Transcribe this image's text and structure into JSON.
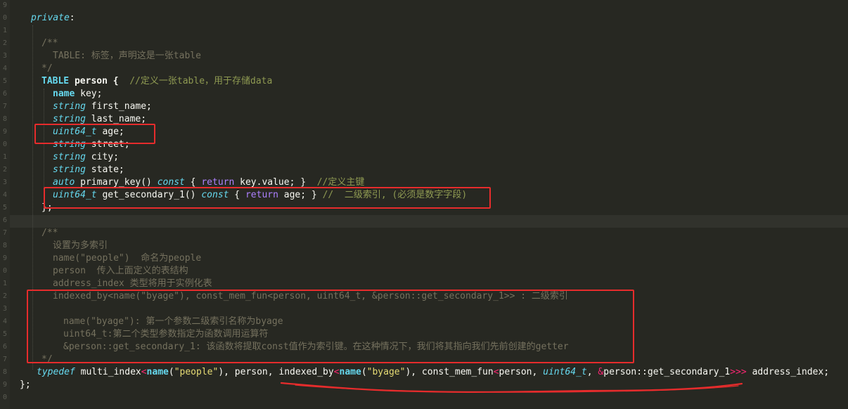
{
  "lines": {
    "l1": [
      "private",
      ":"
    ],
    "l2": [
      "/**"
    ],
    "l3": [
      "TABLE: 标签，声明这是一张table"
    ],
    "l4": [
      "*/"
    ],
    "l5": [
      "TABLE",
      " person {  ",
      "//定义一张table，用于存储data"
    ],
    "l6": [
      "name",
      " key;"
    ],
    "l7": [
      "string",
      " first_name;"
    ],
    "l8": [
      "string",
      " last_name;"
    ],
    "l9": [
      "uint64_t",
      " age;"
    ],
    "l10": [
      "string",
      " street;"
    ],
    "l11": [
      "string",
      " city;"
    ],
    "l12": [
      "string",
      " state;"
    ],
    "l13": [
      "auto",
      " primary_key() ",
      "const",
      " { ",
      "return",
      " key.value; }  ",
      "//定义主键"
    ],
    "l14": [
      "uint64_t",
      " get_secondary_1() ",
      "const",
      " { ",
      "return",
      " age; } ",
      "//  二级索引, (必须是数字字段)"
    ],
    "l15": [
      "};"
    ],
    "l16": [
      "/**"
    ],
    "l17": [
      "设置为多索引"
    ],
    "l18": [
      "name(\"people\")  命名为people"
    ],
    "l19": [
      "person  传入上面定义的表结构"
    ],
    "l20": [
      "address_index 类型将用于实例化表"
    ],
    "l21": [
      "indexed_by<name(\"byage\"), const_mem_fun<person, uint64_t, &person::get_secondary_1>> : 二级索引"
    ],
    "l22": [
      "name(\"byage\"): 第一个参数二级索引名称为byage"
    ],
    "l23": [
      "uint64_t:第二个类型参数指定为函数调用运算符"
    ],
    "l24": [
      "&person::get_secondary_1: 该函数将提取const值作为索引键。在这种情况下，我们将其指向我们先前创建的getter"
    ],
    "l25": [
      "*/"
    ],
    "l26": [
      "typedef",
      " multi_index",
      "<",
      "name",
      "(",
      "\"people\"",
      "), person, indexed_by",
      "<",
      "name",
      "(",
      "\"byage\"",
      "), const_mem_fun",
      "<",
      "person, ",
      "uint64_t",
      ", ",
      "&",
      "person::get_secondary_1",
      ">>>",
      " address_index;"
    ],
    "l27": [
      "};"
    ]
  },
  "gutter_marks": [
    "9",
    "0",
    "1",
    "2",
    "3",
    "4",
    "5",
    "6",
    "7",
    "8",
    "9",
    "0",
    "1",
    "2",
    "3",
    "4",
    "5",
    "6",
    "7",
    "8",
    "9",
    "0",
    "1",
    "2",
    "3",
    "4",
    "5",
    "6",
    "7",
    "8",
    "9",
    "0"
  ],
  "colors": {
    "background": "#272822",
    "keyword": "#66d9ef",
    "comment": "#75715e",
    "string": "#e6db74",
    "return": "#ae81ff",
    "annotation": "#e62c2c"
  }
}
